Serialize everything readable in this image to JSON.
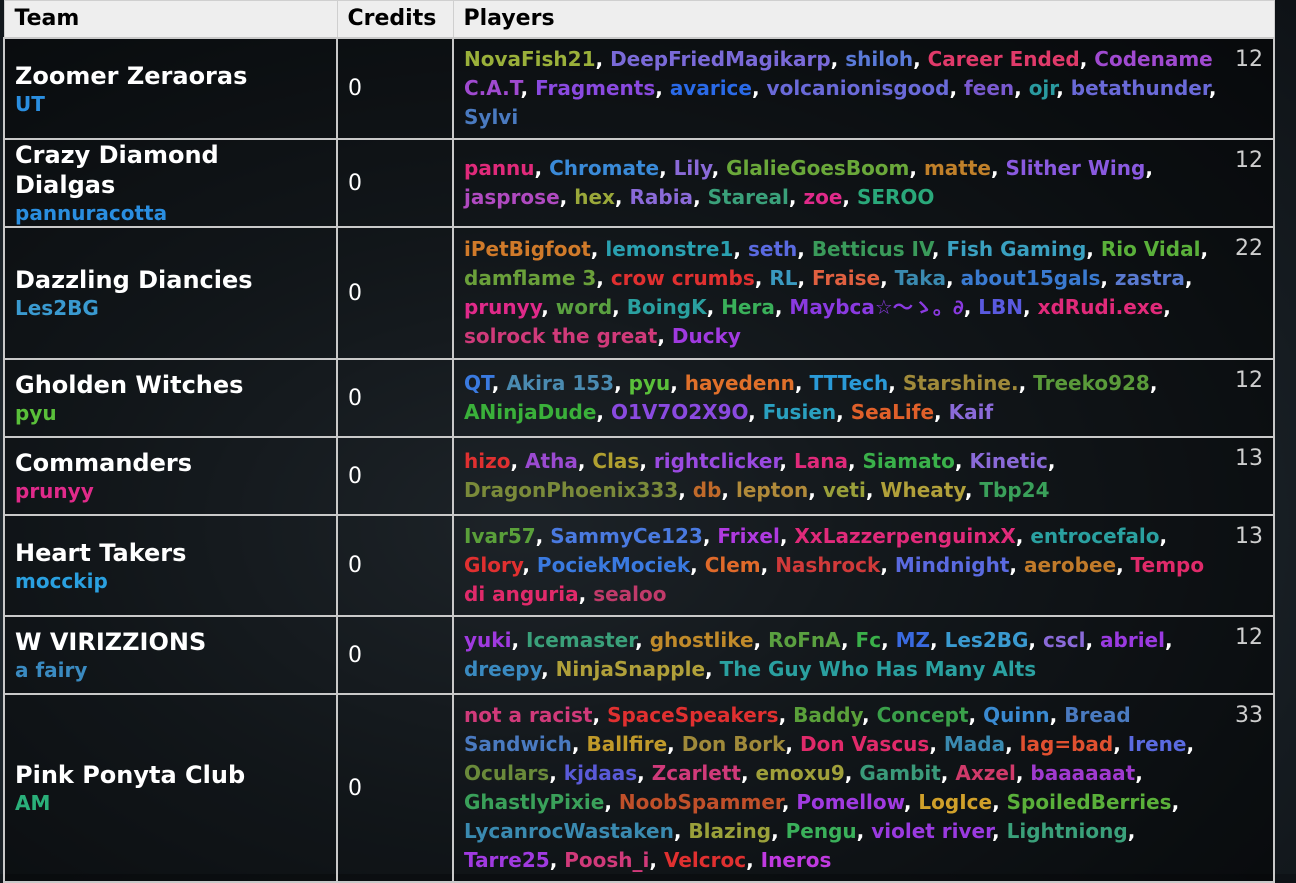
{
  "headers": {
    "team": "Team",
    "credits": "Credits",
    "players": "Players"
  },
  "teams": [
    {
      "name": "Zoomer Zeraoras",
      "owner": "UT",
      "owner_color": "#2a8ee0",
      "credits": "0",
      "count": "12",
      "row_height": 100,
      "players": [
        [
          "NovaFish21",
          "#9ab03a"
        ],
        [
          "DeepFriedMagikarp",
          "#7a6ad8"
        ],
        [
          "shiloh",
          "#5a7ad8"
        ],
        [
          "Career Ended",
          "#e03a6a"
        ],
        [
          "Codename C.A.T",
          "#a04ad0"
        ],
        [
          "Fragments",
          "#8a4ae0"
        ],
        [
          "avarice",
          "#2a6ae8"
        ],
        [
          "volcanionisgood",
          "#6a6ad8"
        ],
        [
          "feen",
          "#7a5ad0"
        ],
        [
          "ojr",
          "#2a9aa0"
        ],
        [
          "betathunder",
          "#6a6ad8"
        ],
        [
          "Sylvi",
          "#4a7ac0"
        ]
      ]
    },
    {
      "name": "Crazy Diamond Dialgas",
      "owner": "pannuracotta",
      "owner_color": "#2a8ee0",
      "credits": "0",
      "count": "12",
      "row_height": 78,
      "players": [
        [
          "pannu",
          "#e02a7a"
        ],
        [
          "Chromate",
          "#3a8ad8"
        ],
        [
          "Lily",
          "#8a6ad8"
        ],
        [
          "GlalieGoesBoom",
          "#6aa83a"
        ],
        [
          "matte",
          "#c0802a"
        ],
        [
          "Slither Wing",
          "#8a5ae0"
        ],
        [
          "jasprose",
          "#b04ac0"
        ],
        [
          "hex",
          "#9aa83a"
        ],
        [
          "Rabia",
          "#8a6ad8"
        ],
        [
          "Stareal",
          "#3aa07a"
        ],
        [
          "zoe",
          "#e02a8a"
        ],
        [
          "SEROO",
          "#2aa87a"
        ]
      ]
    },
    {
      "name": "Dazzling Diancies",
      "owner": "Les2BG",
      "owner_color": "#3a9ad0",
      "credits": "0",
      "count": "22",
      "row_height": 132,
      "players": [
        [
          "iPetBigfoot",
          "#d07a2a"
        ],
        [
          "lemonstre1",
          "#2aa0b0"
        ],
        [
          "seth",
          "#5a6ae0"
        ],
        [
          "Betticus IV",
          "#3a9a5a"
        ],
        [
          "Fish Gaming",
          "#3aa0c0"
        ],
        [
          "Rio Vidal",
          "#5ab03a"
        ],
        [
          "damflame 3",
          "#6aa03a"
        ],
        [
          "crow crumbs",
          "#e03030"
        ],
        [
          "RL",
          "#3a9ac0"
        ],
        [
          "Fraise",
          "#e06040"
        ],
        [
          "Taka",
          "#3a8ab0"
        ],
        [
          "about15gals",
          "#3a7ad0"
        ],
        [
          "zastra",
          "#5a7ad0"
        ],
        [
          "prunyy",
          "#e02a8a"
        ],
        [
          "word",
          "#5aa040"
        ],
        [
          "BoingK",
          "#2aa0a0"
        ],
        [
          "Hera",
          "#3ab05a"
        ],
        [
          "Maybca☆～ゝ。∂",
          "#8a3ae0"
        ],
        [
          "LBN",
          "#5a5ae0"
        ],
        [
          "xdRudi.exe",
          "#e02a7a"
        ],
        [
          "solrock the great",
          "#d03a7a"
        ],
        [
          "Ducky",
          "#a03ae0"
        ]
      ]
    },
    {
      "name": "Gholden Witches",
      "owner": "pyu",
      "owner_color": "#5ac03a",
      "credits": "0",
      "count": "12",
      "row_height": 78,
      "players": [
        [
          "QT",
          "#3a7ae0"
        ],
        [
          "Akira 153",
          "#4a8ab0"
        ],
        [
          "pyu",
          "#5ac03a"
        ],
        [
          "hayedenn",
          "#e0702a"
        ],
        [
          "TTTech",
          "#2a9ad8"
        ],
        [
          "Starshine.",
          "#a08a3a"
        ],
        [
          "Treeko928",
          "#5a9a3a"
        ],
        [
          "ANinjaDude",
          "#3ab03a"
        ],
        [
          "O1V7O2X9O",
          "#8a4ae0"
        ],
        [
          "Fusien",
          "#2aa0c0"
        ],
        [
          "SeaLife",
          "#e0602a"
        ],
        [
          "Kaif",
          "#8a6ad8"
        ]
      ]
    },
    {
      "name": "Commanders",
      "owner": "prunyy",
      "owner_color": "#e02a8a",
      "credits": "0",
      "count": "13",
      "row_height": 78,
      "players": [
        [
          "hizo",
          "#e03030"
        ],
        [
          "Atha",
          "#9a4ad0"
        ],
        [
          "Clas",
          "#b0a030"
        ],
        [
          "rightclicker",
          "#9a4ae0"
        ],
        [
          "Lana",
          "#e02a7a"
        ],
        [
          "Siamato",
          "#3ab04a"
        ],
        [
          "Kinetic",
          "#8a6ad8"
        ],
        [
          "DragonPhoenix333",
          "#7a8a3a"
        ],
        [
          "db",
          "#c06a2a"
        ],
        [
          "lepton",
          "#b08a3a"
        ],
        [
          "veti",
          "#9aa03a"
        ],
        [
          "Wheaty",
          "#b0a03a"
        ],
        [
          "Tbp24",
          "#3aa05a"
        ]
      ]
    },
    {
      "name": "Heart Takers",
      "owner": "mocckip",
      "owner_color": "#2aa0e0",
      "credits": "0",
      "count": "13",
      "row_height": 100,
      "players": [
        [
          "Ivar57",
          "#5aa03a"
        ],
        [
          "SammyCe123",
          "#4a7ae0"
        ],
        [
          "Frixel",
          "#b03ae0"
        ],
        [
          "XxLazzerpenguinxX",
          "#e02a7a"
        ],
        [
          "entrocefalo",
          "#2aa0a0"
        ],
        [
          "Glory",
          "#e03030"
        ],
        [
          "PociekMociek",
          "#3a7ae0"
        ],
        [
          "Clem",
          "#e06a2a"
        ],
        [
          "Nashrock",
          "#d03a3a"
        ],
        [
          "Mindnight",
          "#5a6ae0"
        ],
        [
          "aerobee",
          "#c07a2a"
        ],
        [
          "Tempo di anguria",
          "#e02a6a"
        ],
        [
          "sealoo",
          "#c03a6a"
        ]
      ]
    },
    {
      "name": "W VIRIZZIONS",
      "owner": "a fairy",
      "owner_color": "#3a8ac0",
      "credits": "0",
      "count": "12",
      "row_height": 78,
      "players": [
        [
          "yuki",
          "#a03ae0"
        ],
        [
          "Icemaster",
          "#3aa07a"
        ],
        [
          "ghostlike",
          "#c08a2a"
        ],
        [
          "RoFnA",
          "#5aa040"
        ],
        [
          "Fc",
          "#3ab04a"
        ],
        [
          "MZ",
          "#3a6ae0"
        ],
        [
          "Les2BG",
          "#3a9ad0"
        ],
        [
          "cscl",
          "#8a6ad8"
        ],
        [
          "abriel",
          "#9a3ae0"
        ],
        [
          "dreepy",
          "#3a8ac0"
        ],
        [
          "NinjaSnapple",
          "#b0a03a"
        ],
        [
          "The Guy Who Has Many Alts",
          "#2aa0a0"
        ]
      ]
    },
    {
      "name": "Pink Ponyta Club",
      "owner": "AM",
      "owner_color": "#2ab07a",
      "credits": "0",
      "count": "33",
      "row_height": 188,
      "players": [
        [
          "not a racist",
          "#d03a7a"
        ],
        [
          "SpaceSpeakers",
          "#e03030"
        ],
        [
          "Baddy",
          "#5aa03a"
        ],
        [
          "Concept",
          "#3aa04a"
        ],
        [
          "Quinn",
          "#3a8ad0"
        ],
        [
          "Bread Sandwich",
          "#4a7ac0"
        ],
        [
          "Ballfire",
          "#c09a2a"
        ],
        [
          "Don Bork",
          "#a08a3a"
        ],
        [
          "Don Vascus",
          "#e02a6a"
        ],
        [
          "Mada",
          "#3a8ab0"
        ],
        [
          "lag=bad",
          "#e05030"
        ],
        [
          "Irene",
          "#5a6ae0"
        ],
        [
          "Oculars",
          "#6a8a3a"
        ],
        [
          "kjdaas",
          "#5a5ad8"
        ],
        [
          "Zcarlett",
          "#d03a7a"
        ],
        [
          "emoxu9",
          "#a0a03a"
        ],
        [
          "Gambit",
          "#3a9a7a"
        ],
        [
          "Axzel",
          "#d03a6a"
        ],
        [
          "baaaaaat",
          "#a03ad0"
        ],
        [
          "GhastlyPixie",
          "#3aa05a"
        ],
        [
          "NoobSpammer",
          "#c0502a"
        ],
        [
          "Pomellow",
          "#a03ae0"
        ],
        [
          "LogIce",
          "#d0a02a"
        ],
        [
          "SpoiledBerries",
          "#5ab03a"
        ],
        [
          "LycanrocWastaken",
          "#3a8ab0"
        ],
        [
          "Blazing",
          "#9aa03a"
        ],
        [
          "Pengu",
          "#3ab05a"
        ],
        [
          "violet river",
          "#9a3ae0"
        ],
        [
          "Lightniong",
          "#3aa07a"
        ],
        [
          "Tarre25",
          "#a03ae0"
        ],
        [
          "Poosh_i",
          "#d03a7a"
        ],
        [
          "Velcroc",
          "#e03030"
        ],
        [
          "Ineros",
          "#c03ae0"
        ]
      ]
    }
  ]
}
